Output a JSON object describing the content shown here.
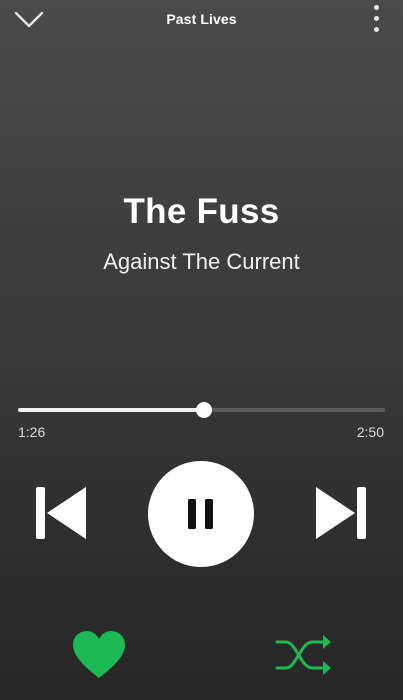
{
  "header": {
    "playlist_title": "Past Lives"
  },
  "track": {
    "title": "The Fuss",
    "artist": "Against The Current"
  },
  "playback": {
    "elapsed": "1:26",
    "total": "2:50",
    "progress": 0.506,
    "state": "playing"
  },
  "icons": {
    "collapse": "chevron-down-icon",
    "menu": "more-vertical-icon",
    "previous": "skip-previous-icon",
    "pause": "pause-icon",
    "next": "skip-next-icon",
    "like": "heart-icon",
    "shuffle": "shuffle-icon"
  },
  "colors": {
    "accent": "#1db954",
    "text": "#ffffff"
  },
  "status": {
    "liked": true,
    "shuffle_on": true
  }
}
